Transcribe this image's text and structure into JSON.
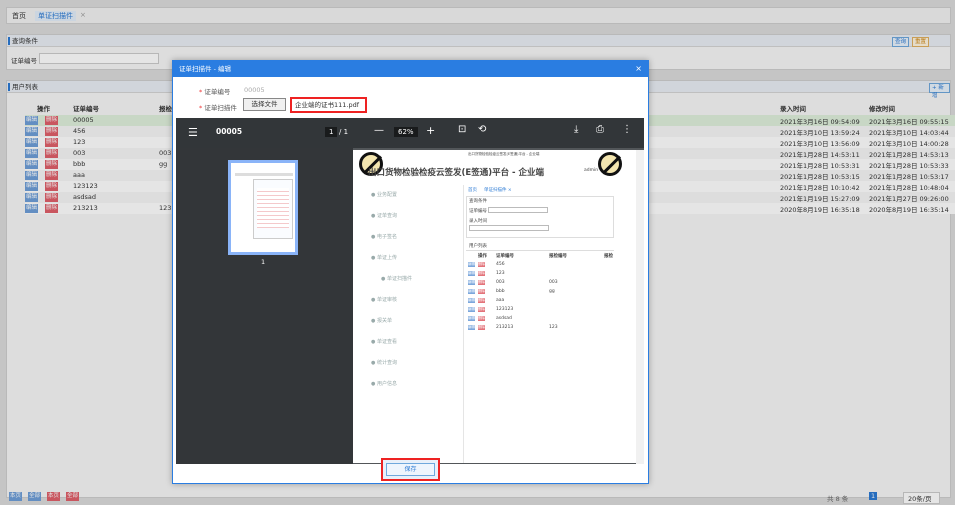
{
  "tabs": [
    "首页",
    "单证扫描件",
    "×"
  ],
  "query": {
    "title": "查询条件",
    "field_label": "证单编号",
    "right_buttons": [
      "查询",
      "重置"
    ]
  },
  "list": {
    "title": "用户列表",
    "add_label": "+ 新增",
    "headers": [
      "操作",
      "证单编号",
      "报检",
      "录入时间",
      "修改时间"
    ],
    "edit": "编辑",
    "del": "删除",
    "rows": [
      {
        "no": "00005",
        "bj": "",
        "in": "2021年3月16日 09:54:09",
        "mod": "2021年3月16日 09:55:15"
      },
      {
        "no": "456",
        "bj": "",
        "in": "2021年3月10日 13:59:24",
        "mod": "2021年3月10日 14:03:44"
      },
      {
        "no": "123",
        "bj": "",
        "in": "2021年3月10日 13:56:09",
        "mod": "2021年3月10日 14:00:28"
      },
      {
        "no": "003",
        "bj": "003",
        "in": "2021年1月28日 14:53:11",
        "mod": "2021年1月28日 14:53:13"
      },
      {
        "no": "bbb",
        "bj": "gg",
        "in": "2021年1月28日 10:53:31",
        "mod": "2021年1月28日 10:53:33"
      },
      {
        "no": "aaa",
        "bj": "",
        "in": "2021年1月28日 10:53:15",
        "mod": "2021年1月28日 10:53:17"
      },
      {
        "no": "123123",
        "bj": "",
        "in": "2021年1月28日 10:10:42",
        "mod": "2021年1月28日 10:48:04"
      },
      {
        "no": "asdsad",
        "bj": "",
        "in": "2021年1月19日 15:27:09",
        "mod": "2021年1月27日 09:26:00"
      },
      {
        "no": "213213",
        "bj": "123",
        "in": "2020年8月19日 16:35:18",
        "mod": "2020年8月19日 16:35:14"
      }
    ],
    "bottom_buttons": [
      "本页",
      "全部",
      "本页",
      "全部"
    ],
    "pager": {
      "total": "共 8 条",
      "page": "1",
      "size": "20条/页"
    }
  },
  "dialog": {
    "title": "证单扫描件 - 编辑",
    "close": "×",
    "field1_label": "证单编号",
    "field1_value": "00005",
    "field2_label": "证单扫描件",
    "choose_label": "选择文件",
    "file_name": "企业端的证书111.pdf",
    "save_label": "保存"
  },
  "pdf": {
    "doc_title": "00005",
    "page_current": "1",
    "page_total": "/ 1",
    "zoom": "62%",
    "thumb_label": "1",
    "page_small_header": "出口货物检验检疫云签发(E签通)平台 - 企业端",
    "page_heading": "出口货物检验检疫云签发(E签通)平台 - 企业端",
    "admin": "admin",
    "menu": [
      "业务配置",
      "证单查询",
      "电子签名",
      "单证上传",
      "单证扫描件",
      "单证审核",
      "报关单",
      "单证查看",
      "统计查询",
      "用户信息"
    ],
    "inner_tabs": [
      "首页",
      "单证扫描件 ×"
    ],
    "inner_query": "查询条件",
    "inner_field": "证单编号",
    "inner_time": "录入时间",
    "inner_list": "用户列表",
    "inner_headers": [
      "操作",
      "证单编号",
      "报检编号",
      "报检"
    ],
    "inner_rows": [
      [
        "456",
        ""
      ],
      [
        "123",
        ""
      ],
      [
        "003",
        "003"
      ],
      [
        "bbb",
        "gg"
      ],
      [
        "aaa",
        ""
      ],
      [
        "123123",
        ""
      ],
      [
        "asdsad",
        ""
      ],
      [
        "213213",
        "123"
      ]
    ]
  }
}
